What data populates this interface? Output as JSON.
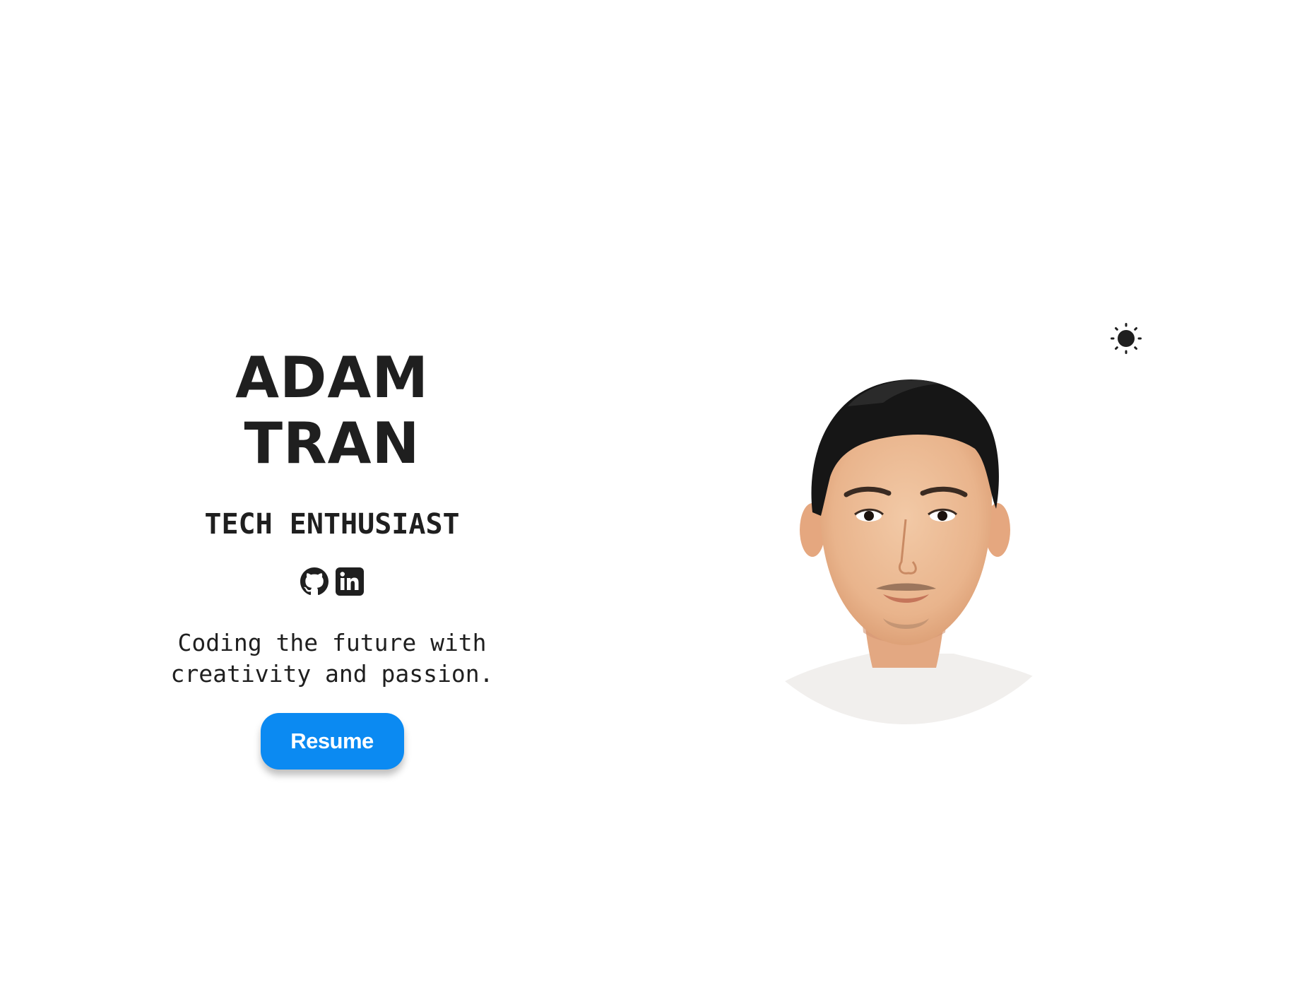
{
  "theme_toggle": {
    "icon": "sun-icon"
  },
  "hero": {
    "name_line1": "ADAM",
    "name_line2": "TRAN",
    "subtitle": "TECH ENTHUSIAST",
    "tagline_line1": "Coding the future with",
    "tagline_line2": "creativity and passion.",
    "resume_label": "Resume"
  },
  "socials": [
    {
      "icon": "github-icon"
    },
    {
      "icon": "linkedin-icon"
    }
  ],
  "colors": {
    "text": "#1f1f1f",
    "accent": "#0b8af2",
    "background": "#ffffff"
  },
  "portrait": {
    "alt": "profile photo"
  }
}
